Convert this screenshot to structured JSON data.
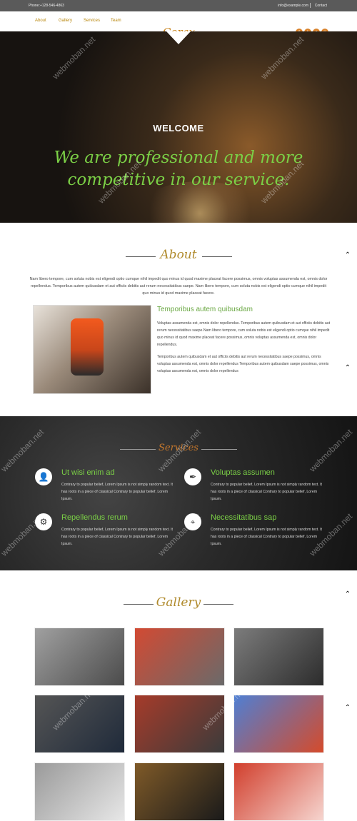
{
  "topbar": {
    "phone": "Phone:+128-546-4863",
    "email": "info@example.com",
    "contact": "Contact"
  },
  "nav": {
    "items": [
      "About",
      "Gallery",
      "Services",
      "Team"
    ],
    "logo": "Corax"
  },
  "hero": {
    "welcome": "WELCOME",
    "tagline": "We are professional and more competitive in our service."
  },
  "about": {
    "title": "About",
    "intro": "Nam libero tempore, cum soluta nobis est eligendi optio cumque nihil impedit quo minus id quod maxime placeat facere possimus, omnis voluptas assumenda est, omnis dolor repellendus. Temporibus autem quibusdam et aut officiis debitis aut rerum necessitatibus saepe. Nam libero tempore, cum soluta nobis est eligendi optio cumque nihil impedit quo minus id quod maxime placeat facere.",
    "subtitle": "Temporibus autem quibusdam",
    "p1": "Voluptas assumenda est, omnis dolor repellendus. Temporibus autem quibusdam et aut officiis debitis aut rerum necessitatibus saepe.Nam libero tempore, cum soluta nobis est eligendi optio cumque nihil impedit quo minus id quod maxime placeat facere possimus, omnis voluptas assumenda est, omnis dolor repellendus.",
    "p2": "Temporibus autem quibusdam et aut officiis debitis aut rerum necessitatibus saepe possimus, omnis voluptas assumenda est, omnis dolor repellendus Temporibus autem quibusdam saepe possimus, omnis voluptas assumenda est, omnis dolor repellendus"
  },
  "services": {
    "title": "Services",
    "items": [
      {
        "title": "Ut wisi enim ad",
        "text": "Contrary to popular belief, Lorem Ipsum is not simply random text. It has roots in a piece of classical Contrary to popular belief, Lorem Ipsum."
      },
      {
        "title": "Voluptas assumen",
        "text": "Contrary to popular belief, Lorem Ipsum is not simply random text. It has roots in a piece of classical Contrary to popular belief, Lorem Ipsum."
      },
      {
        "title": "Repellendus rerum",
        "text": "Contrary to popular belief, Lorem Ipsum is not simply random text. It has roots in a piece of classical Contrary to popular belief, Lorem Ipsum."
      },
      {
        "title": "Necessitatibus sap",
        "text": "Contrary to popular belief, Lorem Ipsum is not simply random text. It has roots in a piece of classical Contrary to popular belief, Lorem Ipsum."
      }
    ]
  },
  "gallery": {
    "title": "Gallery"
  },
  "watermark": "webmoban.net"
}
